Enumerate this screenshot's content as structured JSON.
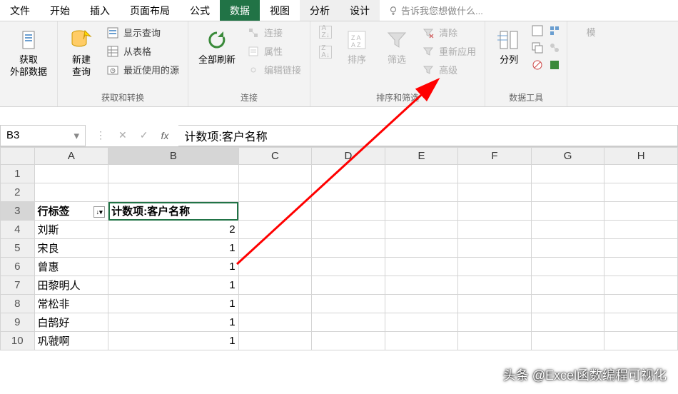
{
  "tabs": {
    "file": "文件",
    "home": "开始",
    "insert": "插入",
    "layout": "页面布局",
    "formula": "公式",
    "data": "数据",
    "view": "视图",
    "analyze": "分析",
    "design": "设计"
  },
  "tell_me": "告诉我您想做什么...",
  "ribbon": {
    "ext_data": {
      "big": "获取\n外部数据"
    },
    "gettransform": {
      "new_query": "新建\n查询",
      "show_queries": "显示查询",
      "from_table": "从表格",
      "recent": "最近使用的源",
      "label": "获取和转换"
    },
    "connections": {
      "refresh_all": "全部刷新",
      "connections": "连接",
      "properties": "属性",
      "edit_links": "编辑链接",
      "label": "连接"
    },
    "sortfilter": {
      "sort": "排序",
      "filter": "筛选",
      "clear": "清除",
      "reapply": "重新应用",
      "advanced": "高级",
      "label": "排序和筛选"
    },
    "datatools": {
      "split": "分列",
      "label": "数据工具"
    },
    "model": "模"
  },
  "name_box": "B3",
  "formula_value": "计数项:客户名称",
  "columns": [
    "A",
    "B",
    "C",
    "D",
    "E",
    "F",
    "G",
    "H"
  ],
  "row_start": 1,
  "pivot": {
    "header_row": 3,
    "row_label_header": "行标签",
    "value_header": "计数项:客户名称",
    "rows": [
      {
        "label": "刘斯",
        "count": 2
      },
      {
        "label": "宋良",
        "count": 1
      },
      {
        "label": "曾惠",
        "count": 1
      },
      {
        "label": "田黎明人",
        "count": 1
      },
      {
        "label": "常松非",
        "count": 1
      },
      {
        "label": "白鹄好",
        "count": 1
      },
      {
        "label": "巩虢啊",
        "count": 1
      }
    ]
  },
  "watermark": "头条 @Excel函数编程可视化"
}
